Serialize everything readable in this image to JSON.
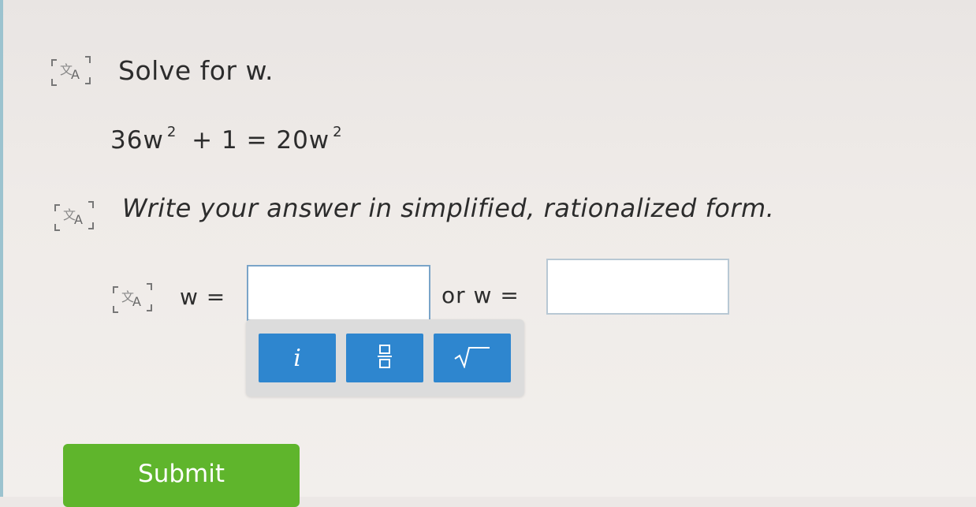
{
  "question": {
    "prompt": "Solve for w.",
    "equation": {
      "left_coeff": "36w",
      "left_exp": "2",
      "middle": "+ 1 = 20w",
      "right_exp": "2"
    },
    "instructions": "Write your answer in simplified, rationalized form."
  },
  "answer": {
    "label_first": "w =",
    "label_second": "or w =",
    "value_first": "",
    "value_second": ""
  },
  "keypad": {
    "imaginary_label": "i",
    "fraction_icon": "fraction-icon",
    "sqrt_icon": "square-root-icon",
    "button_color": "#2e86cf"
  },
  "submit": {
    "label": "Submit",
    "color": "#5fb52c"
  },
  "icons": {
    "translate": "translate-icon"
  }
}
